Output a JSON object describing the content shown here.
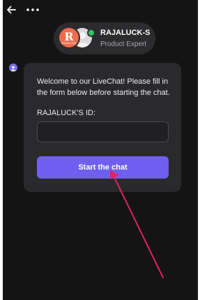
{
  "header": {
    "back_icon": "arrow-left-icon",
    "more_icon": "more-horizontal-icon"
  },
  "agent": {
    "name": "RAJALUCK-S",
    "role": "Product Expert",
    "brand_initial": "R",
    "brand_text": "RAJALUCK",
    "online": true,
    "status_color": "#36c35f",
    "brand_color": "#ee6b4d"
  },
  "chat": {
    "welcome_message": "Welcome to our LiveChat! Please fill in the form below before starting the chat.",
    "form": {
      "id_label": "RAJALUCK'S ID:",
      "id_value": "",
      "id_placeholder": ""
    },
    "start_button_label": "Start the chat"
  },
  "colors": {
    "background": "#141414",
    "card": "#2a2a2c",
    "accent": "#6f5ff0",
    "annotation_arrow": "#e0245e"
  }
}
